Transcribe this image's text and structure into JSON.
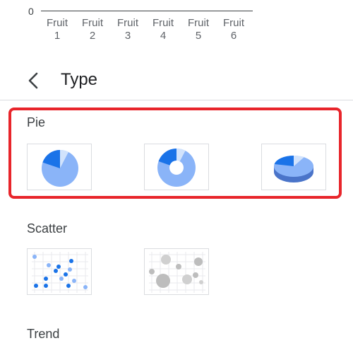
{
  "chart_axis": {
    "zero_label": "0",
    "categories": [
      {
        "line1": "Fruit",
        "line2": "1"
      },
      {
        "line1": "Fruit",
        "line2": "2"
      },
      {
        "line1": "Fruit",
        "line2": "3"
      },
      {
        "line1": "Fruit",
        "line2": "4"
      },
      {
        "line1": "Fruit",
        "line2": "5"
      },
      {
        "line1": "Fruit",
        "line2": "6"
      }
    ]
  },
  "header": {
    "title": "Type",
    "back_icon": "chevron-left-icon"
  },
  "sections": {
    "pie": {
      "label": "Pie",
      "options": [
        {
          "icon": "pie-chart-icon"
        },
        {
          "icon": "donut-chart-icon"
        },
        {
          "icon": "3d-pie-chart-icon"
        }
      ]
    },
    "scatter": {
      "label": "Scatter",
      "options": [
        {
          "icon": "scatter-chart-icon"
        },
        {
          "icon": "bubble-chart-icon"
        }
      ]
    },
    "trend": {
      "label": "Trend"
    }
  },
  "colors": {
    "highlight": "#e8252b",
    "pie_light": "#8ab4f8",
    "pie_dark": "#1a73e8",
    "pie_pale": "#d2e3fc",
    "bubble_gray": "#bdbdbd"
  }
}
